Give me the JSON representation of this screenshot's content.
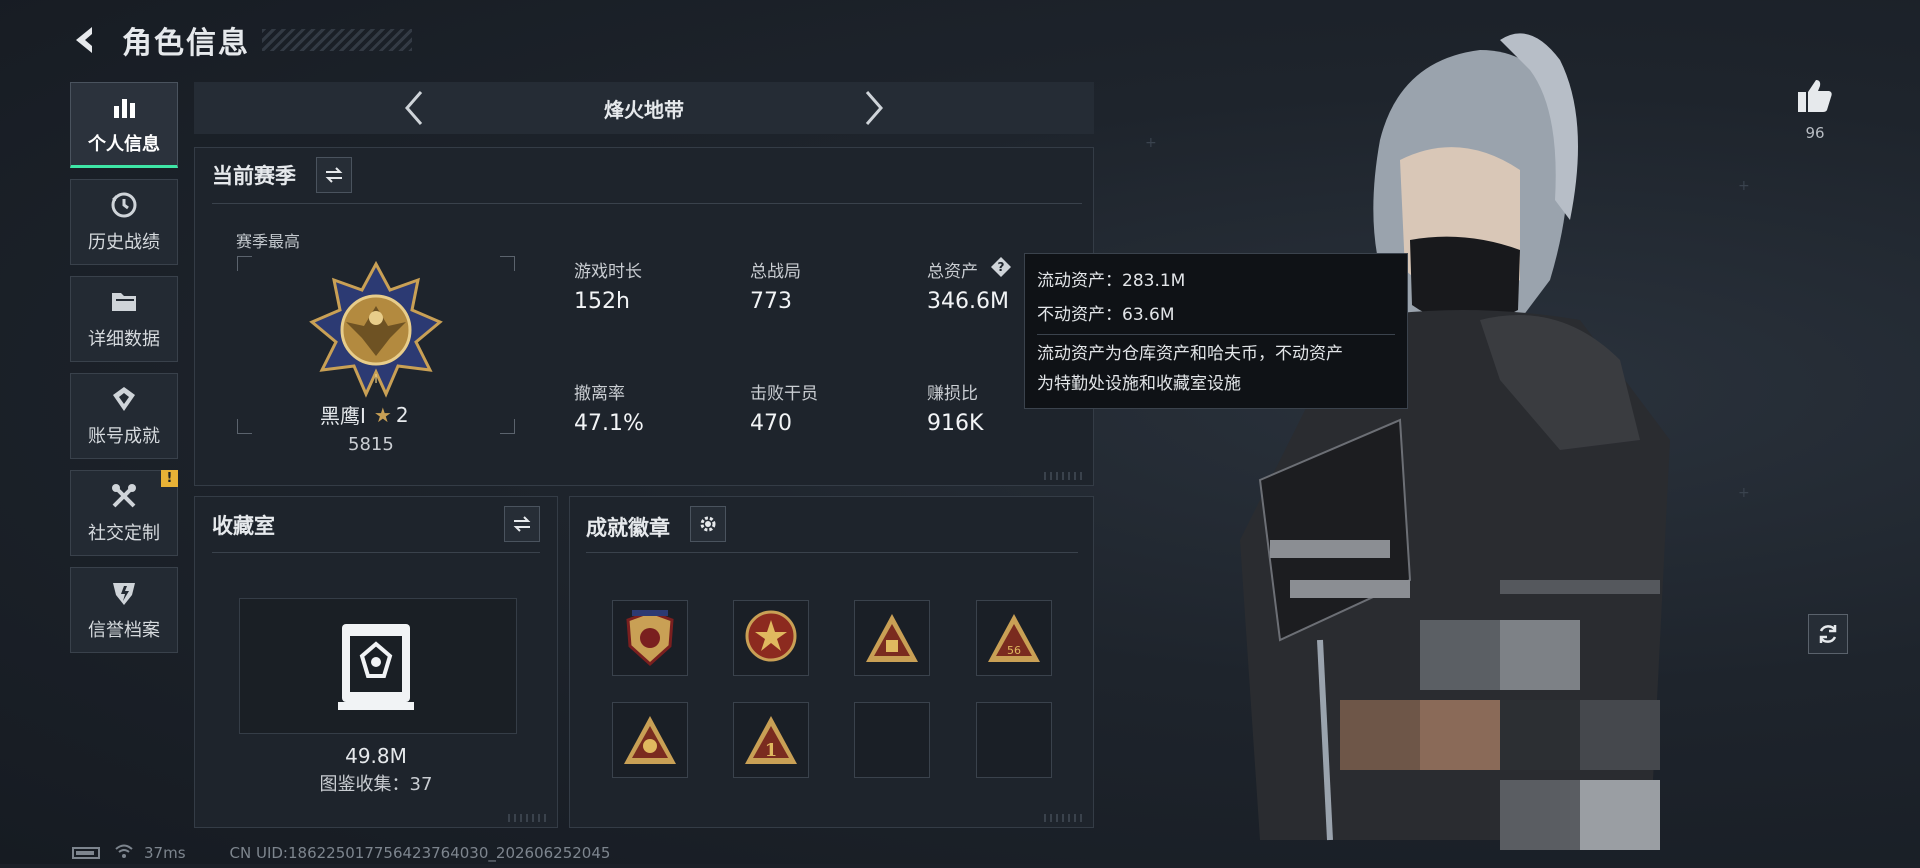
{
  "header": {
    "title": "角色信息"
  },
  "sidebar": {
    "items": [
      {
        "label": "个人信息",
        "icon": "bar-chart-icon",
        "active": true
      },
      {
        "label": "历史战绩",
        "icon": "history-icon"
      },
      {
        "label": "详细数据",
        "icon": "folder-icon"
      },
      {
        "label": "账号成就",
        "icon": "achievement-icon"
      },
      {
        "label": "社交定制",
        "icon": "tools-icon",
        "alert": "!"
      },
      {
        "label": "信誉档案",
        "icon": "reputation-icon"
      }
    ]
  },
  "mode": {
    "name": "烽火地带"
  },
  "season": {
    "title": "当前赛季",
    "best_label": "赛季最高",
    "rank_name": "黑鹰I",
    "rank_stars": "2",
    "rank_score": "5815",
    "stats": [
      {
        "label": "游戏时长",
        "value": "152h"
      },
      {
        "label": "总战局",
        "value": "773"
      },
      {
        "label": "总资产",
        "value": "346.6M"
      },
      {
        "label": "撤离率",
        "value": "47.1%"
      },
      {
        "label": "击败干员",
        "value": "470"
      },
      {
        "label": "赚损比",
        "value": "916K"
      }
    ]
  },
  "tooltip": {
    "line1": "流动资产：283.1M",
    "line2": "不动资产：63.6M",
    "desc1": "流动资产为仓库资产和哈夫币，不动资产",
    "desc2": "为特勤处设施和收藏室设施"
  },
  "collection": {
    "title": "收藏室",
    "value": "49.8M",
    "count_text": "图鉴收集：37"
  },
  "achievements": {
    "title": "成就徽章",
    "badges": [
      "shield-badge-icon",
      "star-badge-icon",
      "triangle-badge-icon",
      "triangle-56-badge-icon",
      "triangle-lantern-badge-icon",
      "triangle-1-badge-icon",
      "",
      ""
    ]
  },
  "like": {
    "count": "96"
  },
  "footer": {
    "ping": "37ms",
    "uid": "CN UID:1862250177564237640​30_202606252045"
  },
  "colors": {
    "accent": "#3ee6a6",
    "warn": "#e8b236",
    "gold": "#c9a055"
  }
}
